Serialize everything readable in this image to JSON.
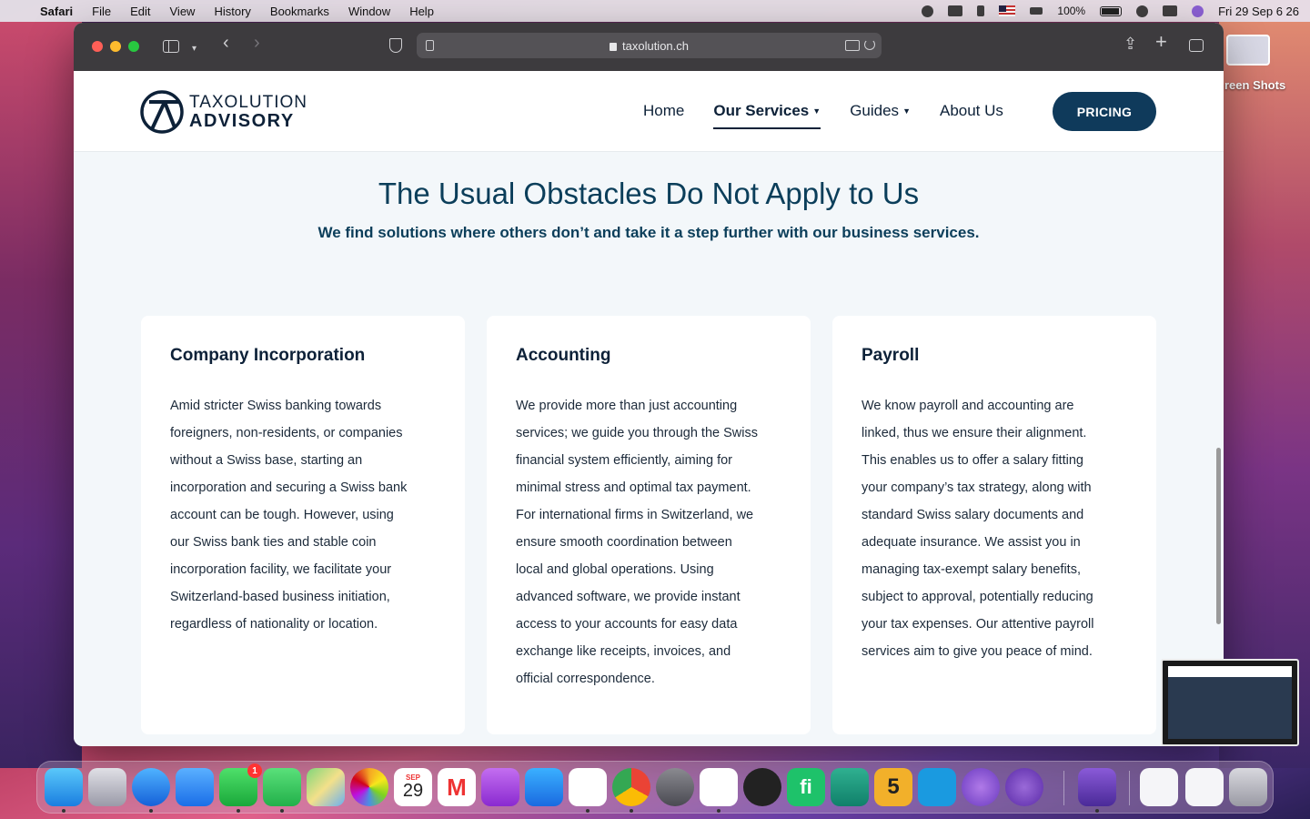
{
  "menubar": {
    "app": "Safari",
    "items": [
      "File",
      "Edit",
      "View",
      "History",
      "Bookmarks",
      "Window",
      "Help"
    ],
    "battery": "100%",
    "datetime": "Fri 29 Sep  6 26"
  },
  "desktop": {
    "folder_label": "reen Shots"
  },
  "browser": {
    "url": "taxolution.ch"
  },
  "site": {
    "logo_line1": "TAXOLUTION",
    "logo_line2": "ADVISORY",
    "nav": {
      "home": "Home",
      "services": "Our Services",
      "guides": "Guides",
      "about": "About Us"
    },
    "pricing_button": "PRICING",
    "heading": "The Usual Obstacles Do Not Apply to Us",
    "subheading": "We find solutions where others don’t and take it a step further with our business services.",
    "cards": [
      {
        "title": "Company Incorporation",
        "lines": [
          "Amid stricter Swiss banking towards",
          "foreigners, non-residents, or companies",
          "without a Swiss base, starting an",
          "incorporation and securing a Swiss bank",
          "account can be tough. However, using",
          "our Swiss bank ties and stable coin",
          "incorporation facility, we facilitate your",
          "Switzerland-based business initiation,",
          "regardless of nationality or location."
        ]
      },
      {
        "title": "Accounting",
        "lines": [
          "We provide more than just accounting",
          "services; we guide you through the Swiss",
          "financial system efficiently, aiming for",
          "minimal stress and optimal tax payment.",
          "For international firms in Switzerland, we",
          "ensure smooth coordination between",
          "local and global operations. Using",
          "advanced software, we provide instant",
          "access to your accounts for easy data",
          "exchange like receipts, invoices, and",
          "official correspondence."
        ]
      },
      {
        "title": "Payroll",
        "lines": [
          "We know payroll and accounting are",
          "linked, thus we ensure their alignment.",
          "This enables us to offer a salary fitting",
          "your company’s tax strategy, along with",
          "standard Swiss salary documents and",
          "adequate insurance. We assist you in",
          "managing tax-exempt salary benefits,",
          "subject to approval, potentially reducing",
          "your tax expenses. Our attentive payroll",
          "services aim to give you peace of mind."
        ]
      }
    ]
  },
  "dock": {
    "calendar_month": "SEP",
    "calendar_day": "29",
    "facetime_badge": "1",
    "app5_label": "5"
  },
  "colors": {
    "brand_navy": "#0f3a5b",
    "heading_teal": "#0b3e5a",
    "page_bg": "#f3f7fa"
  }
}
